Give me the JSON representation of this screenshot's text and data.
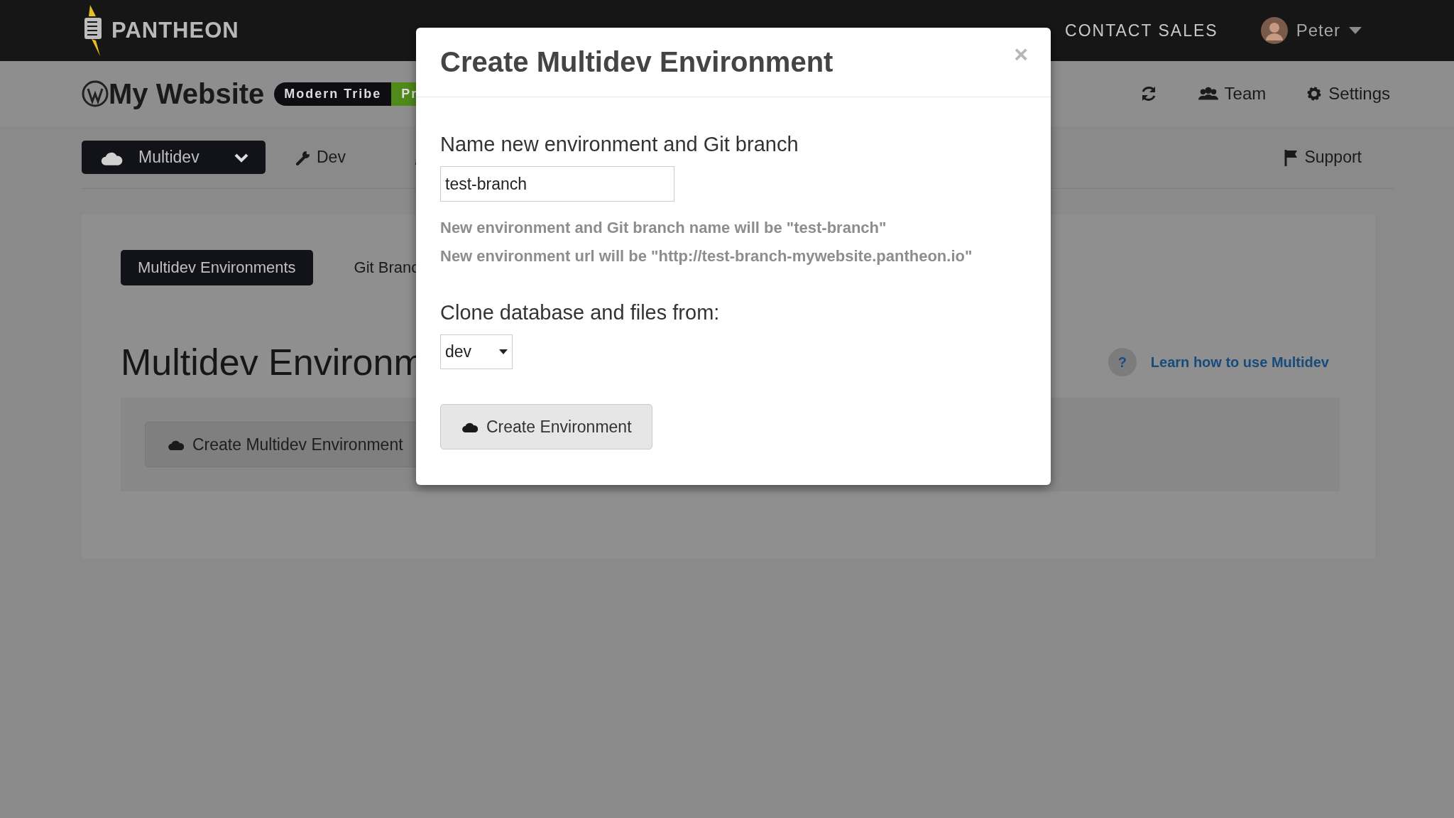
{
  "top_bar": {
    "logo": "PANTHEON",
    "nav": [
      {
        "label": "CONTACT SALES"
      }
    ],
    "user": {
      "name": "Peter"
    }
  },
  "site_header": {
    "title": "My Website",
    "badges": [
      {
        "label": "Modern Tribe",
        "color": "#0d0d12"
      },
      {
        "label": "Pr",
        "color": "#4f8a1b"
      }
    ],
    "actions": [
      {
        "label": "Team"
      },
      {
        "label": "Settings"
      }
    ]
  },
  "env_nav": {
    "environment_menu": {
      "label": "Multidev"
    },
    "tabs": [
      {
        "label": "Dev"
      }
    ],
    "support": {
      "label": "Support"
    }
  },
  "content": {
    "tabs": [
      {
        "label": "Multidev Environments",
        "selected": true
      },
      {
        "label": "Git Branc",
        "selected": false
      }
    ],
    "heading": "Multidev Environm",
    "help_icon": "?",
    "help_link": "Learn how to use Multidev",
    "create_button": "Create Multidev Environment"
  },
  "modal": {
    "title": "Create Multidev Environment",
    "close": "×",
    "name_label": "Name new environment and Git branch",
    "name_value": "test-branch",
    "hints": [
      "New environment and Git branch name will be \"test-branch\"",
      "New environment url will be \"http://test-branch-mywebsite.pantheon.io\""
    ],
    "clone_label": "Clone database and files from:",
    "clone_from": "dev",
    "submit": "Create Environment"
  }
}
